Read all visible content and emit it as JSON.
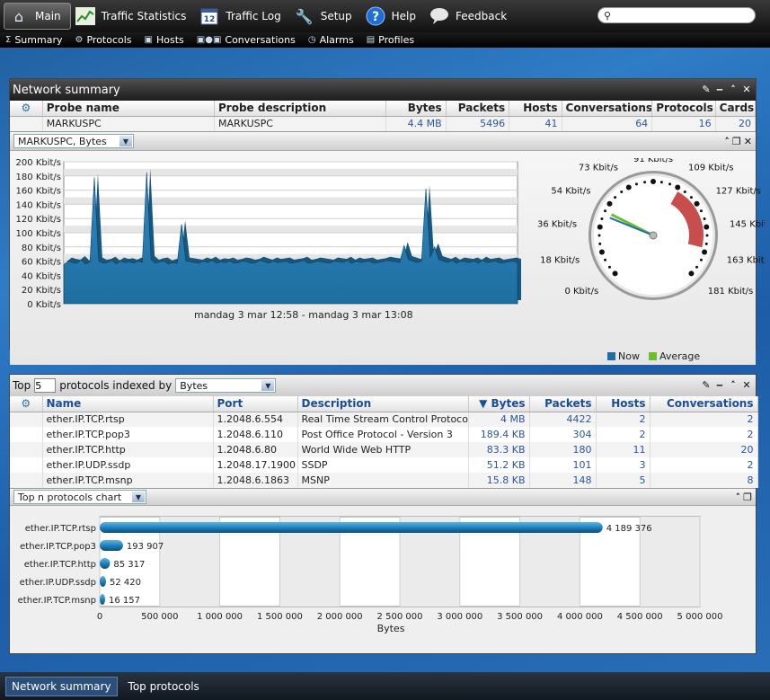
{
  "nav": {
    "items": [
      {
        "label": "Main",
        "icon": "home-icon"
      },
      {
        "label": "Traffic Statistics",
        "icon": "chart-icon"
      },
      {
        "label": "Traffic Log",
        "icon": "calendar-icon"
      },
      {
        "label": "Setup",
        "icon": "wrench-icon"
      },
      {
        "label": "Help",
        "icon": "help-icon"
      },
      {
        "label": "Feedback",
        "icon": "speech-bubble-icon"
      }
    ],
    "search_value": ""
  },
  "subnav": {
    "items": [
      {
        "label": "Summary",
        "icon": "sum-icon"
      },
      {
        "label": "Protocols",
        "icon": "protocol-icon"
      },
      {
        "label": "Hosts",
        "icon": "host-icon"
      },
      {
        "label": "Conversations",
        "icon": "conversation-icon"
      },
      {
        "label": "Alarms",
        "icon": "alarm-clock-icon"
      },
      {
        "label": "Profiles",
        "icon": "profile-icon"
      }
    ]
  },
  "network_summary": {
    "title": "Network summary",
    "columns": [
      "Probe name",
      "Probe description",
      "Bytes",
      "Packets",
      "Hosts",
      "Conversations",
      "Protocols",
      "Cards"
    ],
    "rows": [
      {
        "probe_name": "MARKUSPC",
        "probe_description": "MARKUSPC",
        "bytes": "4.4 MB",
        "packets": "5496",
        "hosts": "41",
        "conversations": "64",
        "protocols": "16",
        "cards": "20"
      }
    ],
    "selector": "MARKUSPC, Bytes",
    "time_range": "mandag 3 mar 12:58 - mandag 3 mar 13:08",
    "legend": {
      "now": "Now",
      "average": "Average",
      "now_color": "#1e6fa8",
      "average_color": "#6abf2a"
    }
  },
  "top_protocols": {
    "label_top": "Top",
    "top_n": "5",
    "label_mid": "protocols indexed by",
    "index_by": "Bytes",
    "columns": [
      "Name",
      "Port",
      "Description",
      "Bytes",
      "Packets",
      "Hosts",
      "Conversations"
    ],
    "sort_indicator": "▼",
    "rows": [
      {
        "name": "ether.IP.TCP.rtsp",
        "port": "1.2048.6.554",
        "description": "Real Time Stream Control Protocol",
        "bytes": "4 MB",
        "packets": "4422",
        "hosts": "2",
        "conversations": "2"
      },
      {
        "name": "ether.IP.TCP.pop3",
        "port": "1.2048.6.110",
        "description": "Post Office Protocol - Version 3",
        "bytes": "189.4 KB",
        "packets": "304",
        "hosts": "2",
        "conversations": "2"
      },
      {
        "name": "ether.IP.TCP.http",
        "port": "1.2048.6.80",
        "description": "World Wide Web HTTP",
        "bytes": "83.3 KB",
        "packets": "180",
        "hosts": "11",
        "conversations": "20"
      },
      {
        "name": "ether.IP.UDP.ssdp",
        "port": "1.2048.17.1900",
        "description": "SSDP",
        "bytes": "51.2 KB",
        "packets": "101",
        "hosts": "3",
        "conversations": "2"
      },
      {
        "name": "ether.IP.TCP.msnp",
        "port": "1.2048.6.1863",
        "description": "MSNP",
        "bytes": "15.8 KB",
        "packets": "148",
        "hosts": "5",
        "conversations": "8"
      }
    ],
    "chart_selector": "Top n protocols chart"
  },
  "chart_data": [
    {
      "type": "area",
      "ylim": [
        0,
        200
      ],
      "yticks": [
        0,
        20,
        40,
        60,
        80,
        100,
        120,
        140,
        160,
        180,
        200
      ],
      "ytick_labels": [
        "0 Kbit/s",
        "20 Kbit/s",
        "40 Kbit/s",
        "60 Kbit/s",
        "80 Kbit/s",
        "100 Kbit/s",
        "120 Kbit/s",
        "140 Kbit/s",
        "160 Kbit/s",
        "180 Kbit/s",
        "200 Kbit/s"
      ],
      "xlabel": "mandag 3 mar 12:58 - mandag 3 mar 13:08",
      "grid": true,
      "series": [
        {
          "values": [
            55,
            60,
            58,
            57,
            62,
            56,
            59,
            178,
            60,
            57,
            58,
            61,
            56,
            60,
            58,
            59,
            57,
            60,
            58,
            185,
            62,
            57,
            59,
            60,
            56,
            58,
            57,
            112,
            60,
            59,
            58,
            57,
            60,
            58,
            61,
            57,
            59,
            58,
            60,
            57,
            58,
            60,
            59,
            57,
            58,
            61,
            59,
            57,
            60,
            58,
            59,
            60,
            57,
            58,
            59,
            61,
            57,
            58,
            60,
            59,
            58,
            57,
            60,
            59,
            58,
            61,
            57,
            60,
            58,
            59,
            60,
            57,
            58,
            59,
            61,
            60,
            59,
            58,
            82,
            62,
            60,
            58,
            60,
            162,
            65,
            80,
            62,
            60,
            58,
            61,
            57,
            60,
            59,
            58,
            60,
            57,
            61,
            58,
            59,
            60,
            57,
            58,
            59,
            60,
            58
          ]
        }
      ]
    },
    {
      "type": "gauge",
      "tick_labels": [
        "0 Kbit/s",
        "18 Kbit/s",
        "36 Kbit/s",
        "54 Kbit/s",
        "73 Kbit/s",
        "91 Kbit/s",
        "109 Kbit/s",
        "127 Kbit/s",
        "145 Kbit/s",
        "163 Kbit/s",
        "181 Kbit/s"
      ],
      "range": [
        0,
        181
      ],
      "now": 45,
      "average": 48,
      "red_zone": [
        110,
        160
      ]
    },
    {
      "type": "bar",
      "orientation": "horizontal",
      "categories": [
        "ether.IP.TCP.rtsp",
        "ether.IP.TCP.pop3",
        "ether.IP.TCP.http",
        "ether.IP.UDP.ssdp",
        "ether.IP.TCP.msnp"
      ],
      "values": [
        4189376,
        193907,
        85317,
        52420,
        16157
      ],
      "value_labels": [
        "4 189 376",
        "193 907",
        "85 317",
        "52 420",
        "16 157"
      ],
      "xlim": [
        0,
        5000000
      ],
      "xticks": [
        0,
        500000,
        1000000,
        1500000,
        2000000,
        2500000,
        3000000,
        3500000,
        4000000,
        4500000,
        5000000
      ],
      "xtick_labels": [
        "0",
        "500 000",
        "1 000 000",
        "1 500 000",
        "2 000 000",
        "2 500 000",
        "3 000 000",
        "3 500 000",
        "4 000 000",
        "4 500 000",
        "5 000 000"
      ],
      "xlabel": "Bytes",
      "color": "#1d84bf"
    }
  ],
  "bottom_tabs": [
    "Network summary",
    "Top protocols"
  ]
}
